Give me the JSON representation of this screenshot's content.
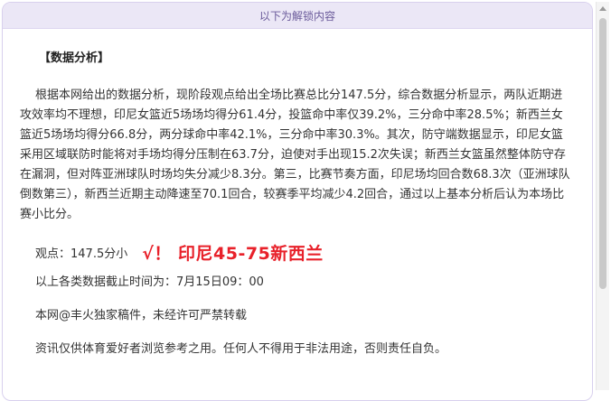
{
  "banner": {
    "text": "以下为解锁内容"
  },
  "article": {
    "section_title": "【数据分析】",
    "paragraph": "根据本网给出的数据分析，现阶段观点给出全场比赛总比分147.5分，综合数据分析显示，两队近期进攻效率均不理想，印尼女篮近5场场均得分61.4分，投篮命中率仅39.2%，三分命中率28.5%；新西兰女篮近5场场均得分66.8分，两分球命中率42.1%，三分命中率30.3%。其次，防守端数据显示，印尼女篮采用区域联防时能将对手场均得分压制在63.7分，迫使对手出现15.2次失误；新西兰女篮虽然整体防守存在漏洞，但对阵亚洲球队时场均失分减少8.3分。第三，比赛节奏方面，印尼场均回合数68.3次（亚洲球队倒数第三），新西兰近期主动降速至70.1回合，较赛季平均减少4.2回合，通过以上基本分析后认为本场比赛小比分。",
    "view_label": "观点：",
    "view_value": "147.5分小",
    "result": "√！ 印尼45-75新西兰",
    "deadline": "以上各类数据截止时间为：7月15日09：00",
    "copyright": "本网@丰火独家稿件，未经许可严禁转载",
    "disclaimer": "资讯仅供体育爱好者浏览参考之用。任何人不得用于非法用途，否则责任自负。"
  },
  "colors": {
    "result": "#e8212a",
    "banner_bg": "#ebe7f6",
    "border": "#d8d0ee"
  }
}
